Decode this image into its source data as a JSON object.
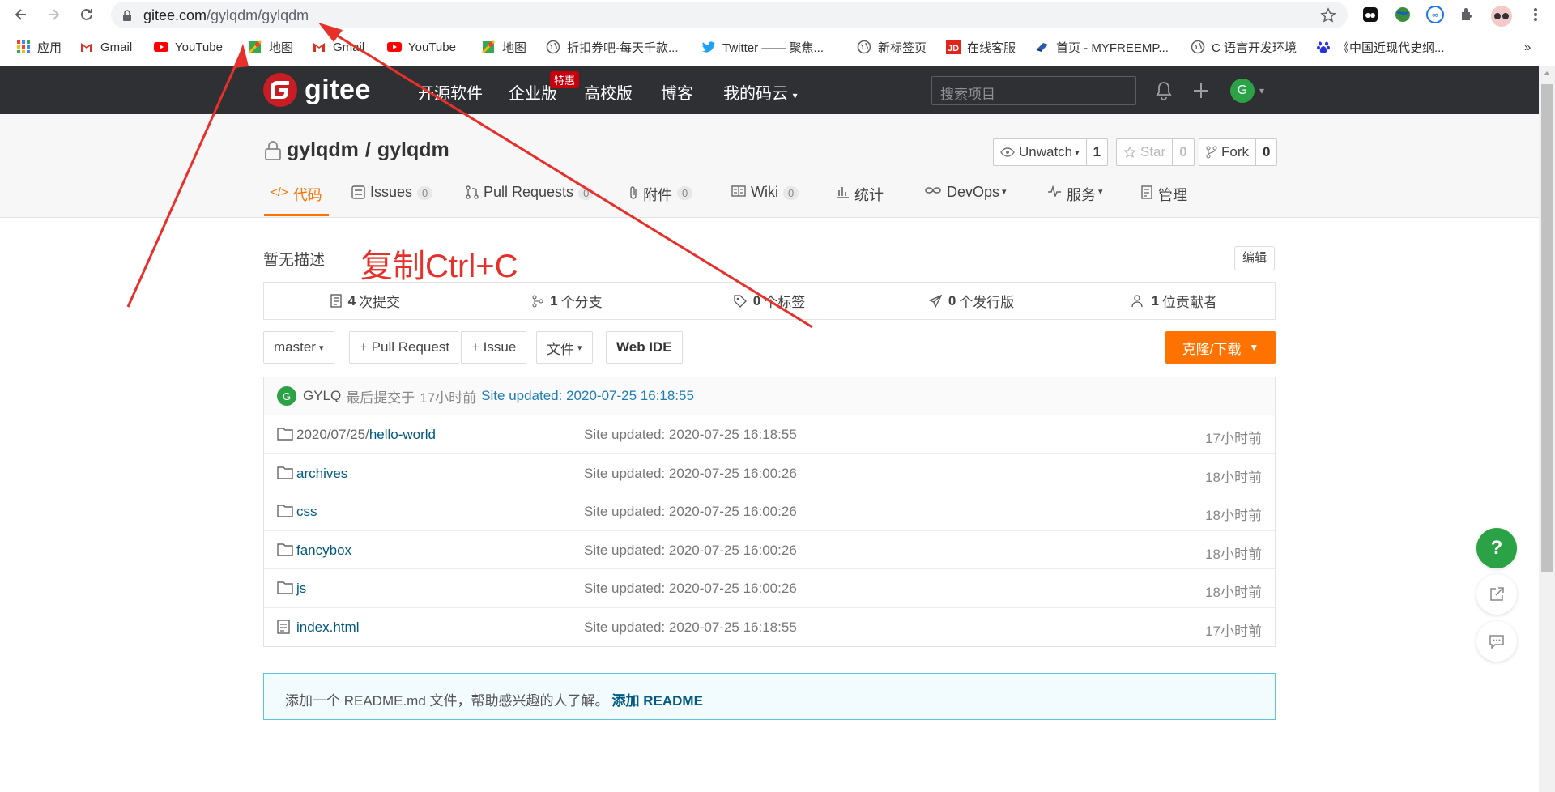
{
  "browser": {
    "url_host": "gitee.com",
    "url_path": "/gylqdm/gylqdm",
    "bookmarks": [
      {
        "label": "应用",
        "icon": "apps-grid-icon"
      },
      {
        "label": "Gmail",
        "icon": "gmail-icon"
      },
      {
        "label": "YouTube",
        "icon": "youtube-icon"
      },
      {
        "label": "地图",
        "icon": "maps-icon"
      },
      {
        "label": "Gmail",
        "icon": "gmail-icon"
      },
      {
        "label": "YouTube",
        "icon": "youtube-icon"
      },
      {
        "label": "地图",
        "icon": "maps-icon"
      },
      {
        "label": "折扣券吧-每天千款...",
        "icon": "globe-icon"
      },
      {
        "label": "Twitter —— 聚焦...",
        "icon": "twitter-icon"
      },
      {
        "label": "新标签页",
        "icon": "globe-icon"
      },
      {
        "label": "在线客服",
        "icon": "jd-icon"
      },
      {
        "label": "首页 - MYFREEMP...",
        "icon": "page-icon"
      },
      {
        "label": "C 语言开发环境",
        "icon": "globe-icon"
      },
      {
        "label": "《中国近现代史纲...",
        "icon": "baidu-icon"
      }
    ],
    "overflow": "»"
  },
  "header": {
    "logo_text": "gitee",
    "nav": [
      "开源软件",
      "企业版",
      "高校版",
      "博客",
      "我的码云"
    ],
    "promo_badge": "特惠",
    "search_placeholder": "搜索项目",
    "avatar_letter": "G"
  },
  "repo": {
    "owner": "gylqdm",
    "separator": "/",
    "name": "gylqdm",
    "watch": {
      "label": "Unwatch",
      "count": "1"
    },
    "star": {
      "label": "Star",
      "count": "0"
    },
    "fork": {
      "label": "Fork",
      "count": "0"
    },
    "tabs": [
      {
        "label": "代码",
        "badge": ""
      },
      {
        "label": "Issues",
        "badge": "0"
      },
      {
        "label": "Pull Requests",
        "badge": "0"
      },
      {
        "label": "附件",
        "badge": "0"
      },
      {
        "label": "Wiki",
        "badge": "0"
      },
      {
        "label": "统计",
        "badge": ""
      },
      {
        "label": "DevOps",
        "badge": ""
      },
      {
        "label": "服务",
        "badge": ""
      },
      {
        "label": "管理",
        "badge": ""
      }
    ],
    "description": "暂无描述",
    "edit_label": "编辑",
    "stats": [
      {
        "count": "4",
        "label": "次提交"
      },
      {
        "count": "1",
        "label": "个分支"
      },
      {
        "count": "0",
        "label": "个标签"
      },
      {
        "count": "0",
        "label": "个发行版"
      },
      {
        "count": "1",
        "label": "位贡献者"
      }
    ],
    "toolbar": {
      "branch": "master",
      "pull_request": "+ Pull Request",
      "issue": "+ Issue",
      "files": "文件",
      "web_ide": "Web IDE",
      "clone": "克隆/下载"
    },
    "last_commit": {
      "avatar": "G",
      "author": "GYLQ",
      "prefix": "最后提交于",
      "time": "17小时前",
      "message": "Site updated: 2020-07-25 16:18:55"
    },
    "files": [
      {
        "dim": "2020/07/25/",
        "name": "hello-world",
        "type": "folder",
        "message": "Site updated: 2020-07-25 16:18:55",
        "time": "17小时前"
      },
      {
        "dim": "",
        "name": "archives",
        "type": "folder",
        "message": "Site updated: 2020-07-25 16:00:26",
        "time": "18小时前"
      },
      {
        "dim": "",
        "name": "css",
        "type": "folder",
        "message": "Site updated: 2020-07-25 16:00:26",
        "time": "18小时前"
      },
      {
        "dim": "",
        "name": "fancybox",
        "type": "folder",
        "message": "Site updated: 2020-07-25 16:00:26",
        "time": "18小时前"
      },
      {
        "dim": "",
        "name": "js",
        "type": "folder",
        "message": "Site updated: 2020-07-25 16:00:26",
        "time": "18小时前"
      },
      {
        "dim": "",
        "name": "index.html",
        "type": "file",
        "message": "Site updated: 2020-07-25 16:18:55",
        "time": "17小时前"
      }
    ],
    "readme_notice": "添加一个 README.md 文件，帮助感兴趣的人了解。",
    "readme_link": "添加 README"
  },
  "annotation": {
    "text": "复制Ctrl+C",
    "color": "#e8302b"
  },
  "floating": {
    "help": "?"
  },
  "colors": {
    "accent": "#fe7300",
    "header_bg": "#2e3033",
    "link": "#005980",
    "avatar": "#2ba245"
  }
}
